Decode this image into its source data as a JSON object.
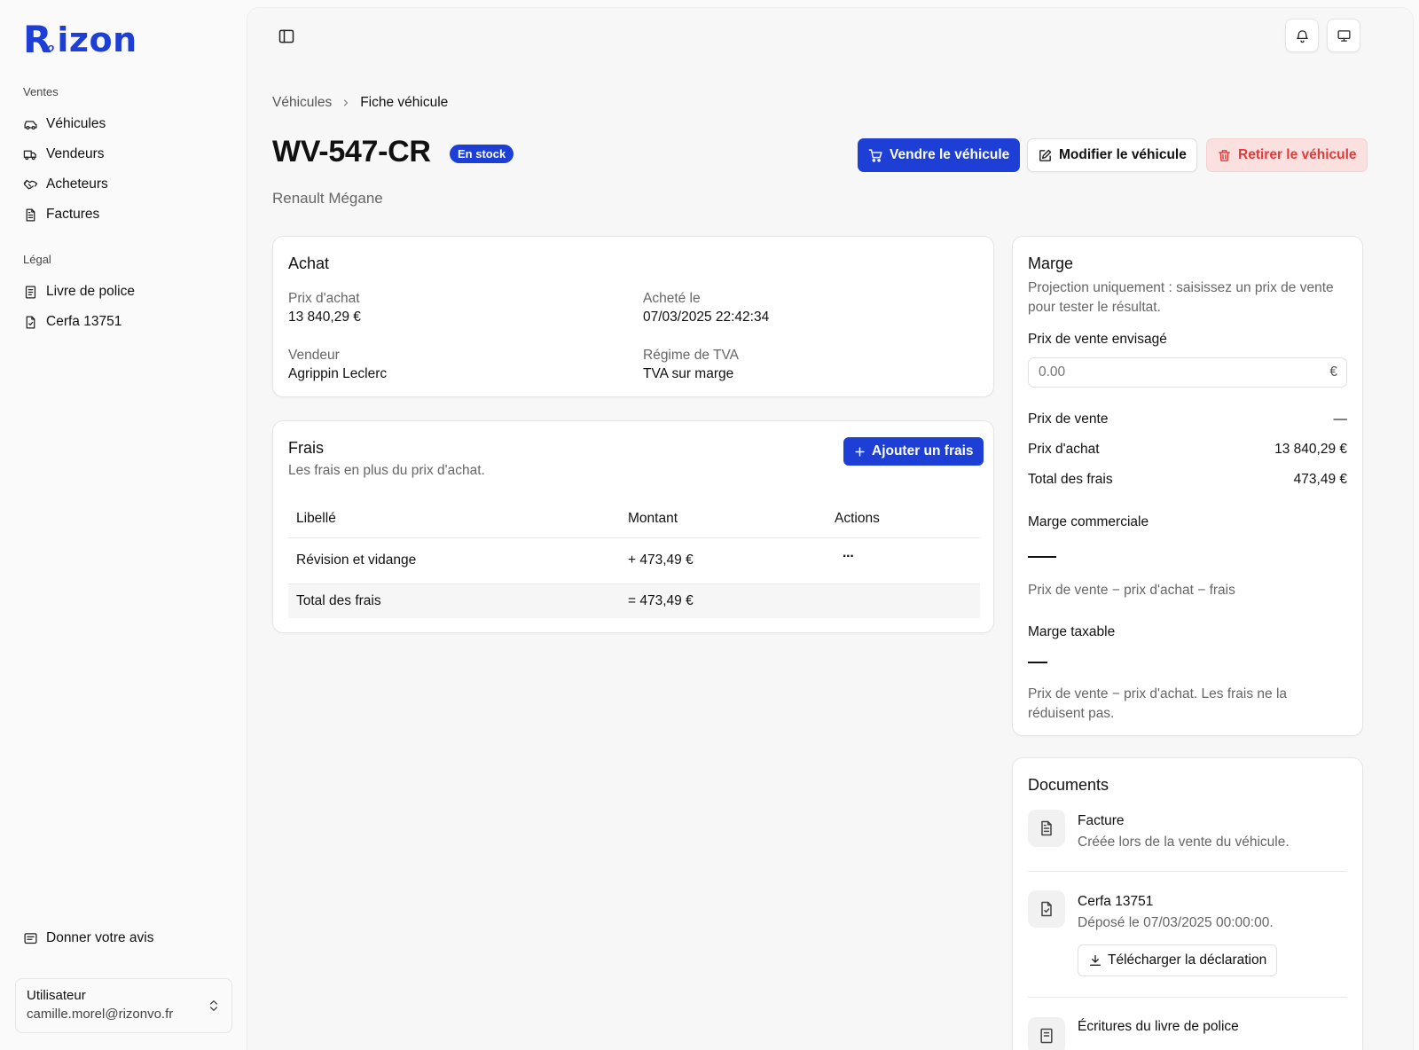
{
  "brand": {
    "logo_r": "R",
    "logo_vo": "vo",
    "logo_text": "izon",
    "color": "#1d3fd6"
  },
  "sidebar": {
    "groups": [
      {
        "label": "Ventes",
        "items": [
          {
            "label": "Véhicules",
            "icon": "car-icon"
          },
          {
            "label": "Vendeurs",
            "icon": "truck-icon"
          },
          {
            "label": "Acheteurs",
            "icon": "handshake-icon"
          },
          {
            "label": "Factures",
            "icon": "file-text-icon"
          }
        ]
      },
      {
        "label": "Légal",
        "items": [
          {
            "label": "Livre de police",
            "icon": "book-icon"
          },
          {
            "label": "Cerfa 13751",
            "icon": "file-check-icon"
          }
        ]
      }
    ],
    "feedback": "Donner votre avis",
    "user": {
      "name": "Utilisateur",
      "email": "camille.morel@rizonvo.fr"
    }
  },
  "breadcrumb": {
    "parent": "Véhicules",
    "current": "Fiche véhicule"
  },
  "vehicle": {
    "plate": "WV-547-CR",
    "status": "En stock",
    "model": "Renault Mégane"
  },
  "actions": {
    "sell": "Vendre le véhicule",
    "edit": "Modifier le véhicule",
    "remove": "Retirer le véhicule"
  },
  "purchase": {
    "title": "Achat",
    "price_label": "Prix d'achat",
    "price": "13 840,29 €",
    "date_label": "Acheté le",
    "date": "07/03/2025 22:42:34",
    "seller_label": "Vendeur",
    "seller": "Agrippin Leclerc",
    "vat_label": "Régime de TVA",
    "vat": "TVA sur marge"
  },
  "fees": {
    "title": "Frais",
    "subtitle": "Les frais en plus du prix d'achat.",
    "add_button": "Ajouter un frais",
    "columns": [
      "Libellé",
      "Montant",
      "Actions"
    ],
    "rows": [
      {
        "label": "Révision et vidange",
        "amount": "+ 473,49 €",
        "actions": "···"
      }
    ],
    "total_label": "Total des frais",
    "total": "= 473,49 €"
  },
  "margin": {
    "title": "Marge",
    "description": "Projection uniquement : saisissez un prix de vente pour tester le résultat.",
    "input_label": "Prix de vente envisagé",
    "input_placeholder": "0.00",
    "currency": "€",
    "sale_price_label": "Prix de vente",
    "sale_price": "—",
    "purchase_price_label": "Prix d'achat",
    "purchase_price": "13 840,29 €",
    "fees_total_label": "Total des frais",
    "fees_total": "473,49 €",
    "commercial_label": "Marge commerciale",
    "commercial_formula": "Prix de vente − prix d'achat − frais",
    "taxable_label": "Marge taxable",
    "taxable_formula": "Prix de vente − prix d'achat. Les frais ne la réduisent pas."
  },
  "documents": {
    "title": "Documents",
    "items": [
      {
        "title": "Facture",
        "subtitle": "Créée lors de la vente du véhicule."
      },
      {
        "title": "Cerfa 13751",
        "subtitle": "Déposé le 07/03/2025 00:00:00.",
        "button": "Télécharger la déclaration"
      },
      {
        "title": "Écritures du livre de police"
      }
    ]
  }
}
